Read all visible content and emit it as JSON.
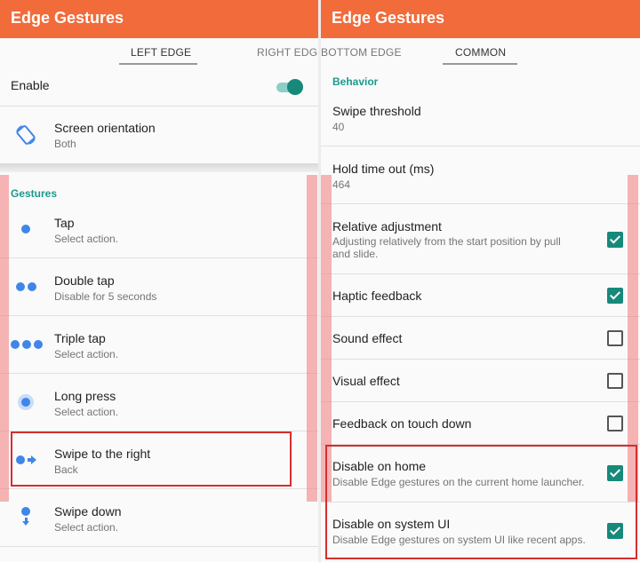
{
  "left": {
    "app_title": "Edge Gestures",
    "tabs": [
      "LEFT EDGE",
      "RIGHT EDGE"
    ],
    "enable_label": "Enable",
    "enable_on": true,
    "orientation": {
      "title": "Screen orientation",
      "value": "Both"
    },
    "gestures_header": "Gestures",
    "gestures": [
      {
        "title": "Tap",
        "action": "Select action.",
        "icon": "single-dot-icon"
      },
      {
        "title": "Double tap",
        "action": "Disable for 5 seconds",
        "icon": "double-dot-icon"
      },
      {
        "title": "Triple tap",
        "action": "Select action.",
        "icon": "triple-dot-icon"
      },
      {
        "title": "Long press",
        "action": "Select action.",
        "icon": "long-press-icon"
      },
      {
        "title": "Swipe to the right",
        "action": "Back",
        "icon": "swipe-right-icon"
      },
      {
        "title": "Swipe down",
        "action": "Select action.",
        "icon": "swipe-down-icon"
      }
    ]
  },
  "right": {
    "app_title": "Edge Gestures",
    "tabs": [
      "BOTTOM EDGE",
      "COMMON"
    ],
    "behavior_header": "Behavior",
    "swipe_threshold": {
      "title": "Swipe threshold",
      "value": "40"
    },
    "hold_timeout": {
      "title": "Hold time out (ms)",
      "value": "464"
    },
    "options": [
      {
        "title": "Relative adjustment",
        "summary": "Adjusting relatively from the start position by pull",
        "summary2": "and slide.",
        "checked": true
      },
      {
        "title": "Haptic feedback",
        "summary": "",
        "checked": true
      },
      {
        "title": "Sound effect",
        "summary": "",
        "checked": false
      },
      {
        "title": "Visual effect",
        "summary": "",
        "checked": false
      },
      {
        "title": "Feedback on touch down",
        "summary": "",
        "checked": false
      },
      {
        "title": "Disable on home",
        "summary": "Disable Edge gestures on the current home launcher.",
        "checked": true
      },
      {
        "title": "Disable on system UI",
        "summary": "Disable Edge gestures on system UI like recent apps.",
        "checked": true
      }
    ]
  },
  "colors": {
    "appbar": "#f26b3a",
    "accent": "#16897a",
    "icon_blue": "#3f86e8",
    "highlight_red": "#d32f2f"
  }
}
